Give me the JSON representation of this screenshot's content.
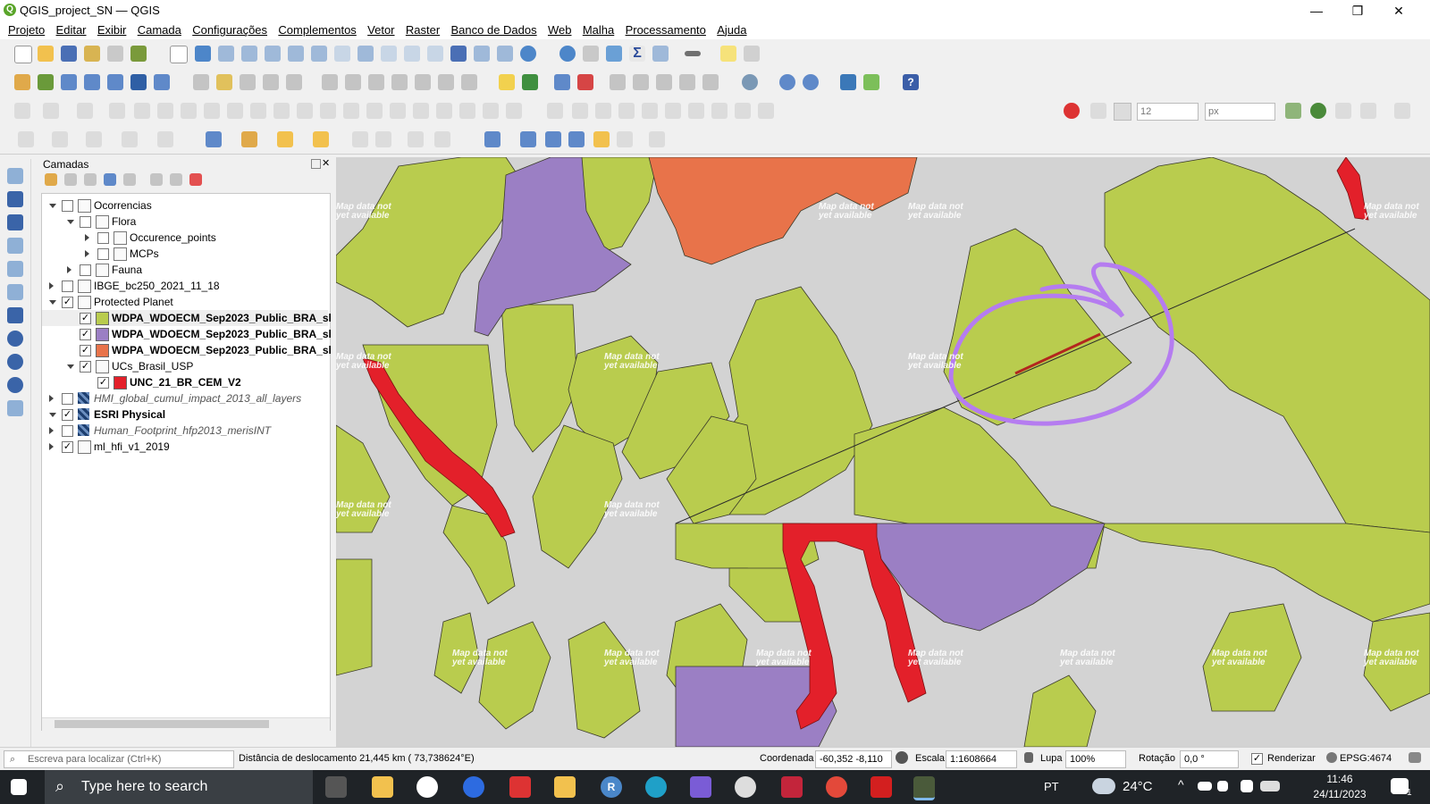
{
  "window": {
    "title": "QGIS_project_SN — QGIS",
    "minimize": "—",
    "restore": "❐",
    "close": "✕"
  },
  "menu": [
    "Projeto",
    "Editar",
    "Exibir",
    "Camada",
    "Configurações",
    "Complementos",
    "Vetor",
    "Raster",
    "Banco de Dados",
    "Web",
    "Malha",
    "Processamento",
    "Ajuda"
  ],
  "snapping": {
    "tolerance": "12",
    "units": "px"
  },
  "layers_panel": {
    "title": "Camadas",
    "items": [
      {
        "label": "Ocorrencias",
        "depth": 0,
        "expanded": true,
        "checked": false,
        "style": "group"
      },
      {
        "label": "Flora",
        "depth": 1,
        "expanded": true,
        "checked": false,
        "style": "group"
      },
      {
        "label": "Occurence_points",
        "depth": 2,
        "expanded": false,
        "checked": false,
        "style": "group"
      },
      {
        "label": "MCPs",
        "depth": 2,
        "expanded": false,
        "checked": false,
        "style": "group"
      },
      {
        "label": "Fauna",
        "depth": 1,
        "expanded": false,
        "checked": false,
        "style": "group"
      },
      {
        "label": "IBGE_bc250_2021_11_18",
        "depth": 0,
        "expanded": false,
        "checked": false,
        "style": "group"
      },
      {
        "label": "Protected Planet",
        "depth": 0,
        "expanded": true,
        "checked": true,
        "style": "group"
      },
      {
        "label": "WDPA_WDOECM_Sep2023_Public_BRA_sl",
        "depth": 1,
        "checked": true,
        "style": "bold",
        "swatch": "#b9cc4e"
      },
      {
        "label": "WDPA_WDOECM_Sep2023_Public_BRA_sl",
        "depth": 1,
        "checked": true,
        "style": "bold",
        "swatch": "#9b7fc4"
      },
      {
        "label": "WDPA_WDOECM_Sep2023_Public_BRA_sl",
        "depth": 1,
        "checked": true,
        "style": "bold",
        "swatch": "#e8734a"
      },
      {
        "label": "UCs_Brasil_USP",
        "depth": 1,
        "expanded": true,
        "checked": true,
        "style": "group"
      },
      {
        "label": "UNC_21_BR_CEM_V2",
        "depth": 2,
        "checked": true,
        "style": "bold",
        "swatch": "#e3202a"
      },
      {
        "label": "HMI_global_cumul_impact_2013_all_layers",
        "depth": 0,
        "expanded": false,
        "checked": false,
        "style": "italic-raster"
      },
      {
        "label": "ESRI Physical",
        "depth": 0,
        "expanded": true,
        "checked": true,
        "style": "bold-raster"
      },
      {
        "label": "Human_Footprint_hfp2013_merisINT",
        "depth": 0,
        "expanded": false,
        "checked": false,
        "style": "italic-raster"
      },
      {
        "label": "ml_hfi_v1_2019",
        "depth": 0,
        "expanded": false,
        "checked": true,
        "style": "group"
      }
    ]
  },
  "map": {
    "watermark_line1": "Map data not",
    "watermark_line2": "yet available",
    "colors": {
      "green": "#b9cc4e",
      "purple": "#9b7fc4",
      "orange": "#e8734a",
      "red": "#e3202a",
      "background": "#d3d3d3",
      "annotation": "#b57cf0"
    }
  },
  "statusbar": {
    "search_placeholder": "Escreva para localizar (Ctrl+K)",
    "message": "Distância de deslocamento 21,445 km ( 73,738624°E)",
    "coord_label": "Coordenada",
    "coord_value": "-60,352 -8,110",
    "scale_label": "Escala",
    "scale_value": "1:1608664",
    "magnifier_label": "Lupa",
    "magnifier_value": "100%",
    "rotation_label": "Rotação",
    "rotation_value": "0,0 °",
    "render_label": "Renderizar",
    "crs": "EPSG:4674"
  },
  "taskbar": {
    "search_placeholder": "Type here to search",
    "lang": "PT",
    "temperature": "24°C",
    "time": "11:46",
    "date": "24/11/2023",
    "notifications": "1"
  }
}
